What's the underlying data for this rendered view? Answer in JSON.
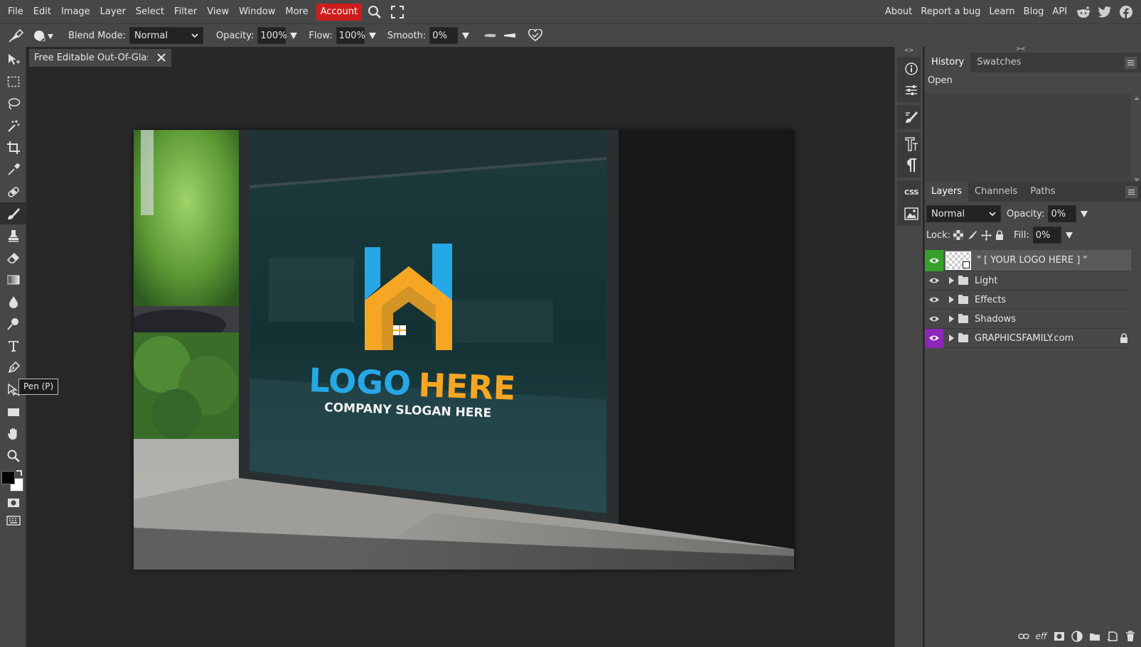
{
  "menubar": {
    "items": [
      "File",
      "Edit",
      "Image",
      "Layer",
      "Select",
      "Filter",
      "View",
      "Window",
      "More"
    ],
    "account_label": "Account",
    "right_items": [
      "About",
      "Report a bug",
      "Learn",
      "Blog",
      "API"
    ],
    "colors": {
      "account": "#cc1d1d"
    }
  },
  "options": {
    "brush_size": "15",
    "blend_label": "Blend Mode:",
    "blend_value": "Normal",
    "opacity_label": "Opacity:",
    "opacity_value": "100%",
    "flow_label": "Flow:",
    "flow_value": "100%",
    "smooth_label": "Smooth:",
    "smooth_value": "0%"
  },
  "toolbar": {
    "tooltip": "Pen (P)"
  },
  "document": {
    "tab_title": "Free Editable Out-Of-Glass",
    "artwork": {
      "logo_word1": "LOGO",
      "logo_word2": "HERE",
      "slogan": "COMPANY SLOGAN HERE",
      "colors": {
        "logo_blue": "#27a8e6",
        "logo_orange": "#f6a623"
      }
    }
  },
  "history": {
    "tabs": [
      "History",
      "Swatches"
    ],
    "items": [
      "Open"
    ]
  },
  "layers": {
    "tabs": [
      "Layers",
      "Channels",
      "Paths"
    ],
    "blend_value": "Normal",
    "opacity_label": "Opacity:",
    "opacity_value": "0%",
    "lock_label": "Lock:",
    "fill_label": "Fill:",
    "fill_value": "0%",
    "items": [
      {
        "name": "\" [ YOUR LOGO HERE ] \"",
        "kind": "smart-object",
        "eye_color": "#36a12a"
      },
      {
        "name": "Light",
        "kind": "folder"
      },
      {
        "name": "Effects",
        "kind": "folder"
      },
      {
        "name": "Shadows",
        "kind": "folder"
      },
      {
        "name": "GRAPHICSFAMILY.com",
        "kind": "folder",
        "eye_color": "#8a27b8",
        "locked": true
      }
    ]
  }
}
